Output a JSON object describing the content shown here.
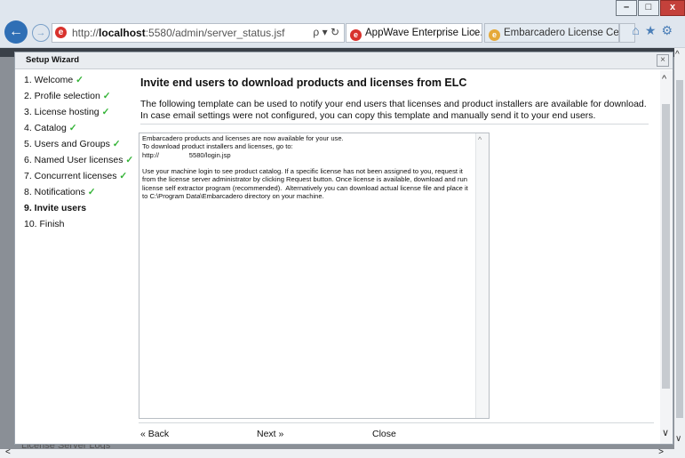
{
  "browser": {
    "url_prefix": "http://",
    "url_host": "localhost",
    "url_rest": ":5580/admin/server_status.jsf",
    "address_tools": "ρ ▾ ↻",
    "tabs": [
      {
        "label": "AppWave Enterprise Lice...",
        "close": "×"
      },
      {
        "label": "Embarcadero License Cent..."
      }
    ],
    "window_controls": {
      "minimize": "–",
      "maximize": "□",
      "close": "x"
    },
    "toolbar_icons": [
      "home-icon",
      "star-icon",
      "gear-icon"
    ]
  },
  "background": {
    "logs_label": "License Server Logs"
  },
  "dialog": {
    "title": "Setup Wizard",
    "close": "×",
    "steps": [
      {
        "label": "1. Welcome",
        "done": true
      },
      {
        "label": "2. Profile selection",
        "done": true
      },
      {
        "label": "3. License hosting",
        "done": true
      },
      {
        "label": "4. Catalog",
        "done": true
      },
      {
        "label": "5. Users and Groups",
        "done": true
      },
      {
        "label": "6. Named User licenses",
        "done": true
      },
      {
        "label": "7. Concurrent licenses",
        "done": true
      },
      {
        "label": "8. Notifications",
        "done": true
      },
      {
        "label": "9. Invite users",
        "done": false,
        "active": true
      },
      {
        "label": "10. Finish",
        "done": false
      }
    ],
    "check_glyph": "✓",
    "heading": "Invite end users to download products and licenses from ELC",
    "description": "The following template can be used to notify your end users that licenses and product installers are available for download. In case email settings were not configured, you can copy this template and manually send it to your end users.",
    "template_lines": [
      "Embarcadero products and licenses are now available for your use.",
      "To download product installers and licenses, go to:",
      "http://                5580/login.jsp",
      "",
      "Use your machine login to see product catalog. If a specific license has not been assigned to you, request it from the license server administrator by clicking Request button. Once license is available, download and run license self extractor program (recommended).  Alternatively you can download actual license file and place it to C:\\Program Data\\Embarcadero directory on your machine."
    ],
    "buttons": {
      "back": "« Back",
      "next": "Next »",
      "close": "Close"
    }
  }
}
